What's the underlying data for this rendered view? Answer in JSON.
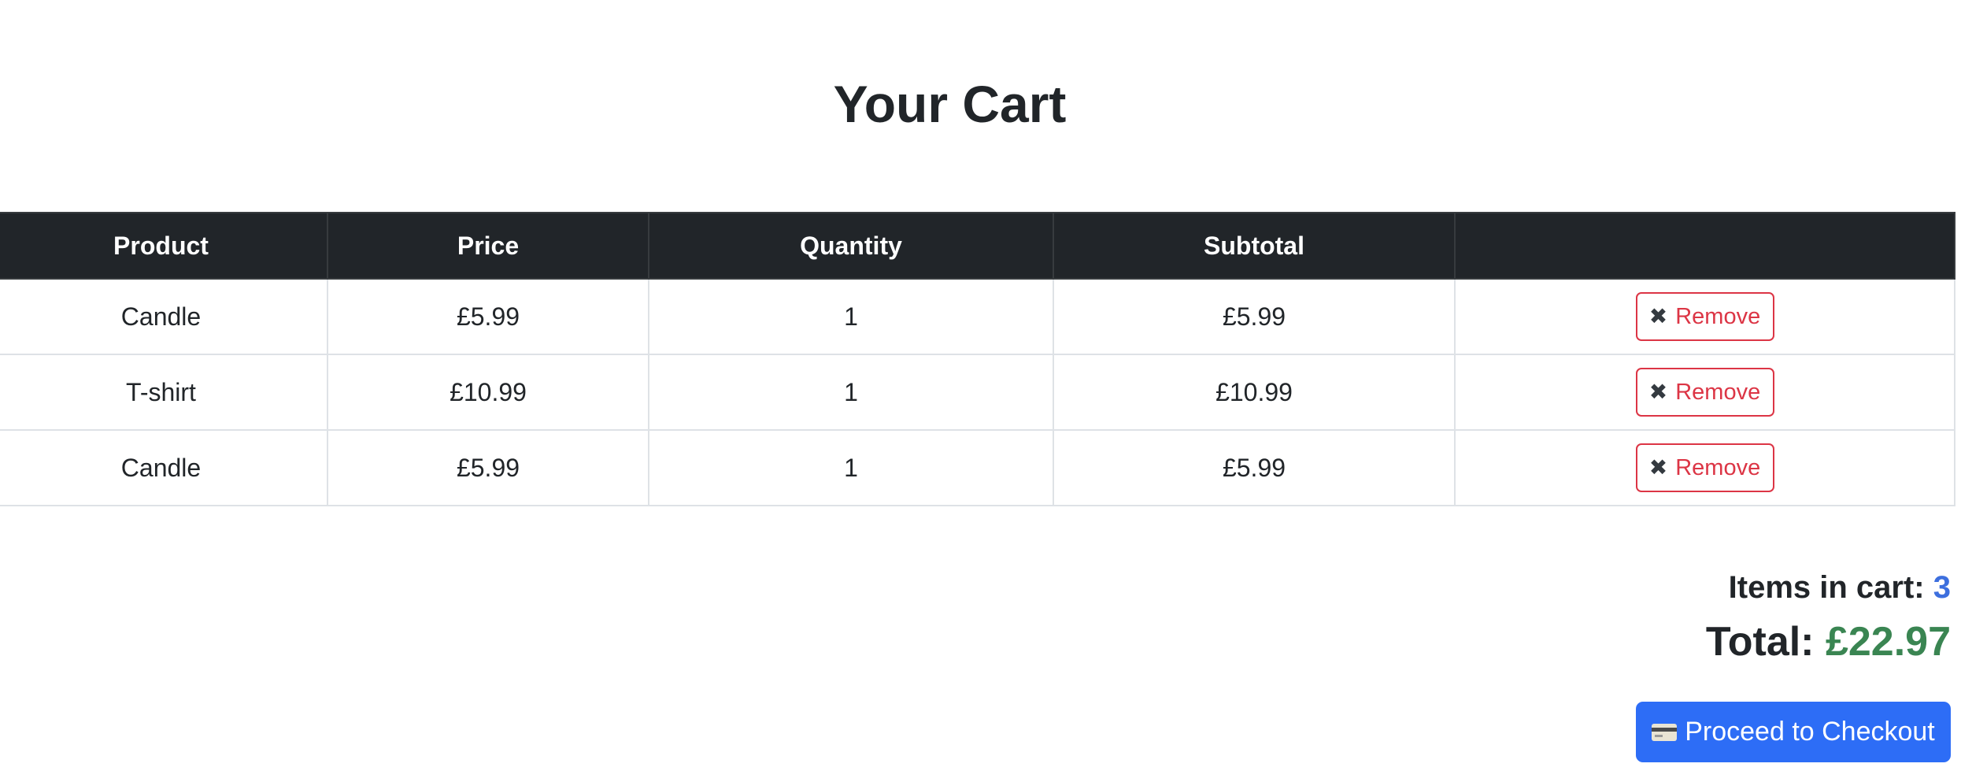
{
  "page": {
    "title": "Your Cart"
  },
  "table": {
    "headers": [
      "Product",
      "Price",
      "Quantity",
      "Subtotal",
      ""
    ],
    "rows": [
      {
        "product": "Candle",
        "price": "£5.99",
        "quantity": "1",
        "subtotal": "£5.99",
        "action_icon": "✖",
        "action_label": "Remove"
      },
      {
        "product": "T-shirt",
        "price": "£10.99",
        "quantity": "1",
        "subtotal": "£10.99",
        "action_icon": "✖",
        "action_label": "Remove"
      },
      {
        "product": "Candle",
        "price": "£5.99",
        "quantity": "1",
        "subtotal": "£5.99",
        "action_icon": "✖",
        "action_label": "Remove"
      }
    ]
  },
  "summary": {
    "items_label": "Items in cart:",
    "items_count": "3",
    "total_label": "Total:",
    "total_amount": "£22.97"
  },
  "checkout": {
    "icon": "credit-card-icon",
    "label": "Proceed to Checkout"
  },
  "colors": {
    "header_bg": "#212529",
    "remove": "#dc3545",
    "count": "#3d6fde",
    "total": "#3a8552",
    "checkout_bg": "#2d6df6"
  }
}
